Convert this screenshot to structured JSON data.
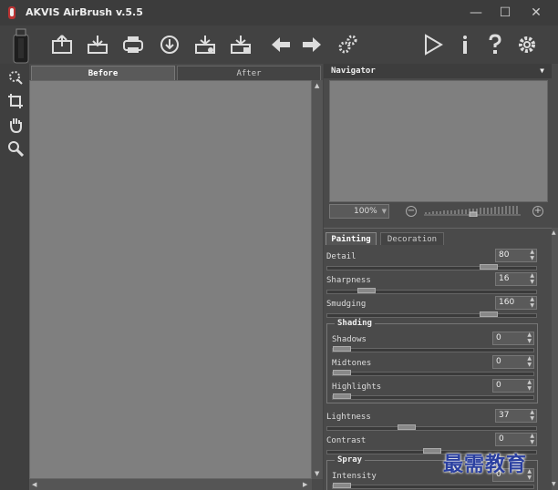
{
  "app": {
    "title": "AKVIS AirBrush v.5.5"
  },
  "window_controls": {
    "minimize": "—",
    "maximize": "☐",
    "close": "✕"
  },
  "toolbar": {
    "items": [
      "open-icon",
      "save-icon",
      "print-icon",
      "share-icon",
      "batch-icon",
      "plugin-icon",
      "undo-icon",
      "redo-icon",
      "settings-gear-icon",
      "run-icon",
      "info-icon",
      "help-icon",
      "preferences-icon"
    ]
  },
  "left_tools": [
    "retouch-icon",
    "crop-icon",
    "hand-icon",
    "zoom-icon"
  ],
  "canvas": {
    "tabs": [
      "Before",
      "After"
    ],
    "active_tab": "Before"
  },
  "navigator": {
    "title": "Navigator",
    "zoom": "100%",
    "zoom_level": 0.5
  },
  "settings": {
    "tabs": [
      "Painting",
      "Decoration"
    ],
    "active_tab": "Painting",
    "params": [
      {
        "label": "Detail",
        "value": "80",
        "level": 0.8
      },
      {
        "label": "Sharpness",
        "value": "16",
        "level": 0.16
      },
      {
        "label": "Smudging",
        "value": "160",
        "level": 0.8
      }
    ],
    "shading": {
      "title": "Shading",
      "params": [
        {
          "label": "Shadows",
          "value": "0",
          "level": 0
        },
        {
          "label": "Midtones",
          "value": "0",
          "level": 0
        },
        {
          "label": "Highlights",
          "value": "0",
          "level": 0
        }
      ]
    },
    "after_params": [
      {
        "label": "Lightness",
        "value": "37",
        "level": 0.37
      },
      {
        "label": "Contrast",
        "value": "0",
        "level": 0.5
      }
    ],
    "spray": {
      "title": "Spray",
      "params": [
        {
          "label": "Intensity",
          "value": "0",
          "level": 0
        }
      ]
    }
  },
  "watermark": "最需教育",
  "colors": {
    "bg": "#444444",
    "canvas": "#7f7f7f",
    "watermark": "#2a3fa0"
  }
}
